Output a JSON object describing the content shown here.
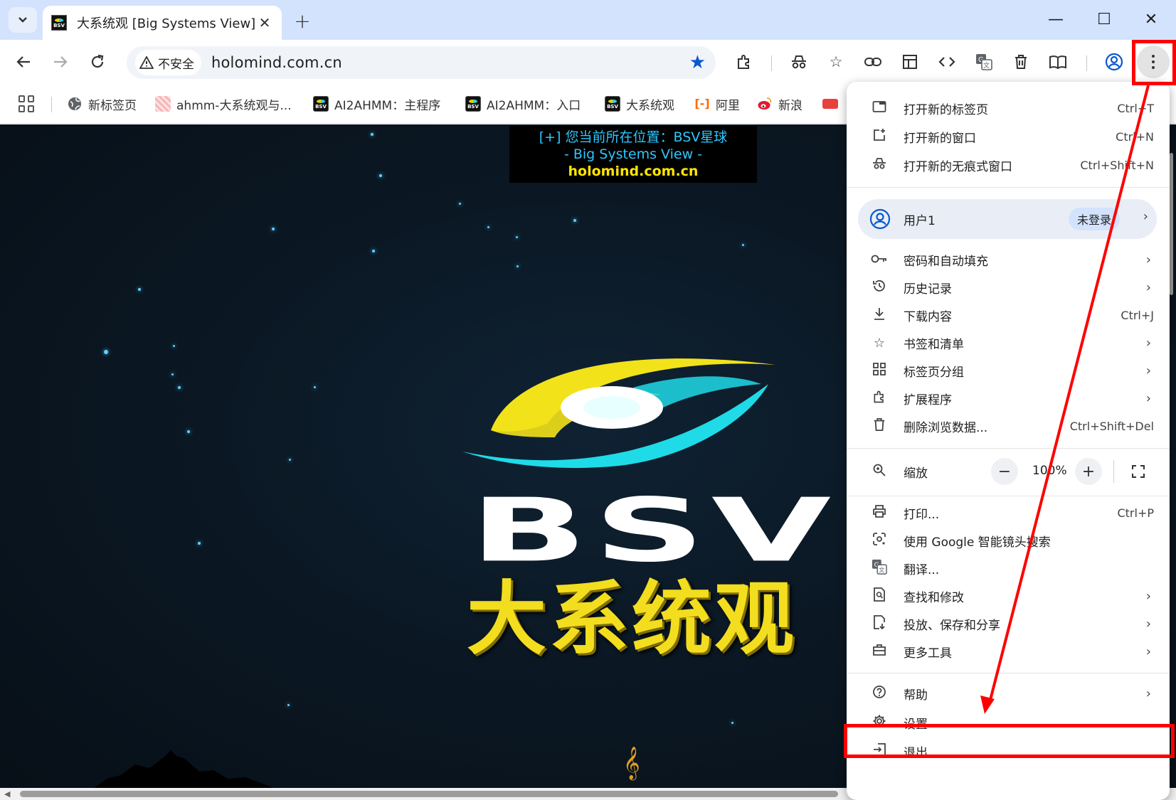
{
  "tab": {
    "title": "大系统观 [Big Systems View]",
    "close": "✕",
    "new_tab": "+"
  },
  "window": {
    "minimize": "—",
    "maximize": "☐",
    "close": "✕"
  },
  "toolbar": {
    "security_label": "不安全",
    "url": "holomind.com.cn"
  },
  "bookmarks": [
    {
      "label": "新标签页",
      "icon": "globe-icon"
    },
    {
      "label": "ahmm-大系统观与...",
      "icon": "pink-favicon"
    },
    {
      "label": "AI2AHMM：主程序",
      "icon": "bsv-favicon"
    },
    {
      "label": "AI2AHMM：入口",
      "icon": "bsv-favicon"
    },
    {
      "label": "大系统观",
      "icon": "bsv-favicon"
    },
    {
      "label": "阿里",
      "icon": "aliyun-icon"
    },
    {
      "label": "新浪",
      "icon": "weibo-icon"
    }
  ],
  "page": {
    "location_line1": "[+] 您当前所在位置：BSV星球",
    "location_line2": "- Big Systems View -",
    "location_line3": "holomind.com.cn",
    "logo_text": "BSV",
    "title_cn": "大系统观",
    "music": "𝄞"
  },
  "menu": {
    "new_tab": {
      "label": "打开新的标签页",
      "shortcut": "Ctrl+T"
    },
    "new_window": {
      "label": "打开新的窗口",
      "shortcut": "Ctrl+N"
    },
    "incognito": {
      "label": "打开新的无痕式窗口",
      "shortcut": "Ctrl+Shift+N"
    },
    "profile": {
      "name": "用户1",
      "status": "未登录"
    },
    "passwords": {
      "label": "密码和自动填充"
    },
    "history": {
      "label": "历史记录"
    },
    "downloads": {
      "label": "下载内容",
      "shortcut": "Ctrl+J"
    },
    "bookmarks": {
      "label": "书签和清单"
    },
    "tab_groups": {
      "label": "标签页分组"
    },
    "extensions": {
      "label": "扩展程序"
    },
    "clear_data": {
      "label": "删除浏览数据...",
      "shortcut": "Ctrl+Shift+Del"
    },
    "zoom": {
      "label": "缩放",
      "value": "100%",
      "minus": "−",
      "plus": "+"
    },
    "print": {
      "label": "打印...",
      "shortcut": "Ctrl+P"
    },
    "lens": {
      "label": "使用 Google 智能镜头搜索"
    },
    "translate": {
      "label": "翻译..."
    },
    "find_edit": {
      "label": "查找和修改"
    },
    "cast_save": {
      "label": "投放、保存和分享"
    },
    "more_tools": {
      "label": "更多工具"
    },
    "help": {
      "label": "帮助"
    },
    "settings": {
      "label": "设置"
    },
    "exit": {
      "label": "退出"
    }
  },
  "colors": {
    "annotation": "#ff0000",
    "accent_blue": "#0b57d0",
    "tabstrip": "#d3e3fd"
  }
}
